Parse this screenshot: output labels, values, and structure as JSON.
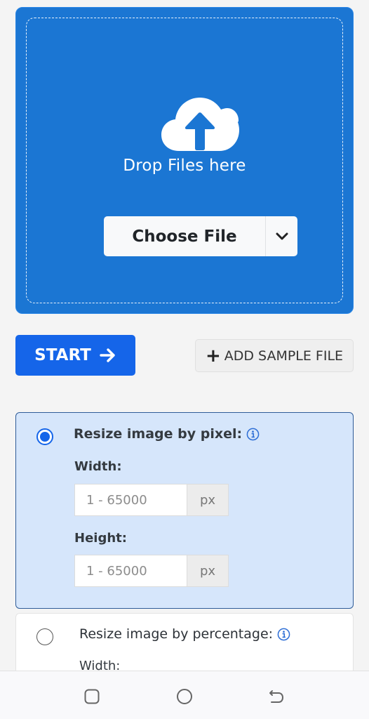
{
  "upload": {
    "icon": "cloud-upload-icon",
    "drop_text": "Drop Files here",
    "choose_file_label": "Choose File",
    "dropdown_icon": "chevron-down-icon"
  },
  "actions": {
    "start_label": "START",
    "start_icon": "arrow-right-icon",
    "add_sample_label": "ADD SAMPLE FILE",
    "add_sample_icon": "plus-icon",
    "plus_glyph": "+",
    "arrow_glyph": "➔"
  },
  "options": [
    {
      "title": "Resize image by pixel:",
      "selected": true,
      "fields": [
        {
          "label": "Width:",
          "placeholder": "1 - 65000",
          "value": "",
          "unit": "px"
        },
        {
          "label": "Height:",
          "placeholder": "1 - 65000",
          "value": "",
          "unit": "px"
        }
      ]
    },
    {
      "title": "Resize image by percentage:",
      "selected": false,
      "fields": [
        {
          "label": "Width:"
        }
      ]
    }
  ],
  "colors": {
    "dropzone": "#1b76d3",
    "primary": "#1565e9",
    "selected_card": "#d6e6fb"
  },
  "navbar": {
    "items": [
      "recent-apps-icon",
      "home-icon",
      "back-icon"
    ]
  }
}
